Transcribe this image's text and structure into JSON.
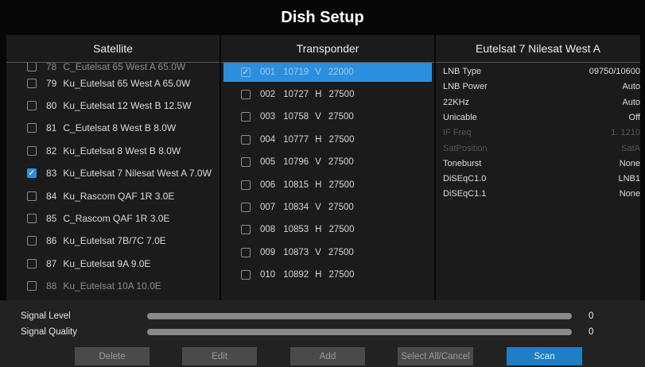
{
  "window": {
    "title": "Dish Setup"
  },
  "satellite_panel": {
    "header": "Satellite",
    "items": [
      {
        "number": "78",
        "name": "C_Eutelsat 65 West A 65.0W",
        "checked": false,
        "partial": true
      },
      {
        "number": "79",
        "name": "Ku_Eutelsat 65 West A 65.0W",
        "checked": false
      },
      {
        "number": "80",
        "name": "Ku_Eutelsat 12 West B 12.5W",
        "checked": false
      },
      {
        "number": "81",
        "name": "C_Eutelsat 8 West B 8.0W",
        "checked": false
      },
      {
        "number": "82",
        "name": "Ku_Eutelsat 8 West B 8.0W",
        "checked": false
      },
      {
        "number": "83",
        "name": "Ku_Eutelsat 7 Nilesat West A 7.0W",
        "checked": true
      },
      {
        "number": "84",
        "name": "Ku_Rascom QAF 1R 3.0E",
        "checked": false
      },
      {
        "number": "85",
        "name": "C_Rascom QAF 1R 3.0E",
        "checked": false
      },
      {
        "number": "86",
        "name": "Ku_Eutelsat 7B/7C 7.0E",
        "checked": false
      },
      {
        "number": "87",
        "name": "Ku_Eutelsat 9A 9.0E",
        "checked": false
      },
      {
        "number": "88",
        "name": "Ku_Eutelsat 10A 10.0E",
        "checked": false,
        "partial": true
      }
    ]
  },
  "transponder_panel": {
    "header": "Transponder",
    "items": [
      {
        "index": "001",
        "frequency": "10719",
        "polarity": "V",
        "symbol_rate": "22000",
        "checked": true,
        "selected": true
      },
      {
        "index": "002",
        "frequency": "10727",
        "polarity": "H",
        "symbol_rate": "27500",
        "checked": false
      },
      {
        "index": "003",
        "frequency": "10758",
        "polarity": "V",
        "symbol_rate": "27500",
        "checked": false
      },
      {
        "index": "004",
        "frequency": "10777",
        "polarity": "H",
        "symbol_rate": "27500",
        "checked": false
      },
      {
        "index": "005",
        "frequency": "10796",
        "polarity": "V",
        "symbol_rate": "27500",
        "checked": false
      },
      {
        "index": "006",
        "frequency": "10815",
        "polarity": "H",
        "symbol_rate": "27500",
        "checked": false
      },
      {
        "index": "007",
        "frequency": "10834",
        "polarity": "V",
        "symbol_rate": "27500",
        "checked": false
      },
      {
        "index": "008",
        "frequency": "10853",
        "polarity": "H",
        "symbol_rate": "27500",
        "checked": false
      },
      {
        "index": "009",
        "frequency": "10873",
        "polarity": "V",
        "symbol_rate": "27500",
        "checked": false
      },
      {
        "index": "010",
        "frequency": "10892",
        "polarity": "H",
        "symbol_rate": "27500",
        "checked": false
      }
    ]
  },
  "info_panel": {
    "header": "Eutelsat 7 Nilesat West A",
    "rows": [
      {
        "label": "LNB Type",
        "value": "09750/10600",
        "dim": false
      },
      {
        "label": "LNB Power",
        "value": "Auto",
        "dim": false
      },
      {
        "label": "22KHz",
        "value": "Auto",
        "dim": false
      },
      {
        "label": "Unicable",
        "value": "Off",
        "dim": false
      },
      {
        "label": "IF Freq",
        "value": "1. 1210",
        "dim": true
      },
      {
        "label": "SatPosition",
        "value": "SatA",
        "dim": true
      },
      {
        "label": "Toneburst",
        "value": "None",
        "dim": false
      },
      {
        "label": "DiSEqC1.0",
        "value": "LNB1",
        "dim": false
      },
      {
        "label": "DiSEqC1.1",
        "value": "None",
        "dim": false
      }
    ]
  },
  "signal": {
    "level": {
      "label": "Signal Level",
      "value": "0",
      "fraction": 0
    },
    "quality": {
      "label": "Signal Quality",
      "value": "0",
      "fraction": 0
    }
  },
  "buttons": {
    "delete": "Delete",
    "edit": "Edit",
    "add": "Add",
    "select_all": "Select All/Cancel",
    "scan": "Scan"
  },
  "colors": {
    "accent": "#2c8fde",
    "panel": "#1b1b1b",
    "background": "#070707"
  },
  "icons": {
    "checkbox_checked": "checkmark-icon"
  }
}
